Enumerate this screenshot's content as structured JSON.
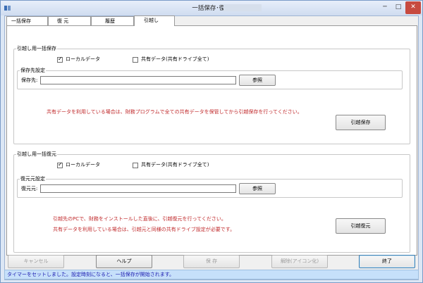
{
  "window": {
    "title": "一括保存･復元",
    "controls": {
      "minimize": "─",
      "maximize": "□",
      "close": "✕"
    }
  },
  "tabs": [
    "一括保存",
    "復 元",
    "履歴",
    "引越し"
  ],
  "save_group": {
    "title": "引越し用一括保存",
    "local_label": "ローカルデータ",
    "local_checked": true,
    "shared_label": "共有データ(共有ドライブ全て)",
    "shared_checked": false,
    "dest_group_title": "保存先設定",
    "dest_label": "保存先:",
    "dest_value": "",
    "browse_label": "参照",
    "note": "共有データを利用している場合は、財務プログラムで全ての共有データを保管してから引越保存を行ってください。",
    "action_label": "引越保存"
  },
  "restore_group": {
    "title": "引越し用一括復元",
    "local_label": "ローカルデータ",
    "local_checked": true,
    "shared_label": "共有データ(共有ドライブ全て)",
    "shared_checked": false,
    "src_group_title": "復元元設定",
    "src_label": "復元元:",
    "src_value": "",
    "browse_label": "参照",
    "note1": "引越先のPCで、財務をインストールした直後に、引越復元を行ってください。",
    "note2": "共有データを利用している場合は、引越元と同様の共有ドライブ設定が必要です。",
    "action_label": "引越復元"
  },
  "bottom_buttons": {
    "cancel": "キャンセル",
    "help": "ヘルプ",
    "save": "保 存",
    "minimize_icon": "解除(アイコン化)",
    "exit": "終了"
  },
  "status": "タイマーをセットしました。設定時刻になると、一括保存が開始されます。"
}
